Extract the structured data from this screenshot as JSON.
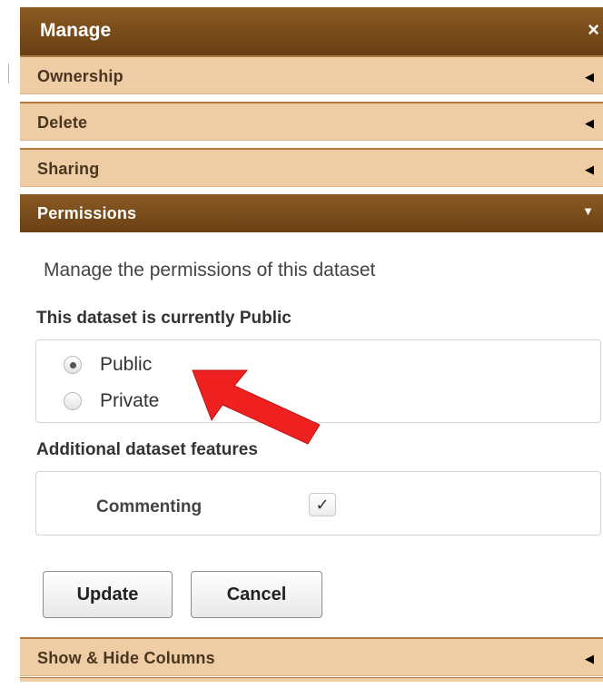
{
  "panel": {
    "title": "Manage",
    "close_glyph": "×",
    "sections": [
      {
        "label": "Ownership",
        "arrow": "◀"
      },
      {
        "label": "Delete",
        "arrow": "◀"
      },
      {
        "label": "Sharing",
        "arrow": "◀"
      },
      {
        "label": "Permissions",
        "arrow": "▼"
      },
      {
        "label": "Show & Hide Columns",
        "arrow": "◀"
      }
    ]
  },
  "permissions": {
    "description": "Manage the permissions of this dataset",
    "status_heading": "This dataset is currently Public",
    "options": [
      {
        "label": "Public",
        "checked": true
      },
      {
        "label": "Private",
        "checked": false
      }
    ],
    "features_heading": "Additional dataset features",
    "feature": {
      "label": "Commenting",
      "checked": true,
      "check_glyph": "✓"
    }
  },
  "buttons": {
    "update": "Update",
    "cancel": "Cancel"
  },
  "colors": {
    "header_brown": "#7a4a1a",
    "section_tan": "#efcda4",
    "annotation_arrow": "#ee2020"
  }
}
